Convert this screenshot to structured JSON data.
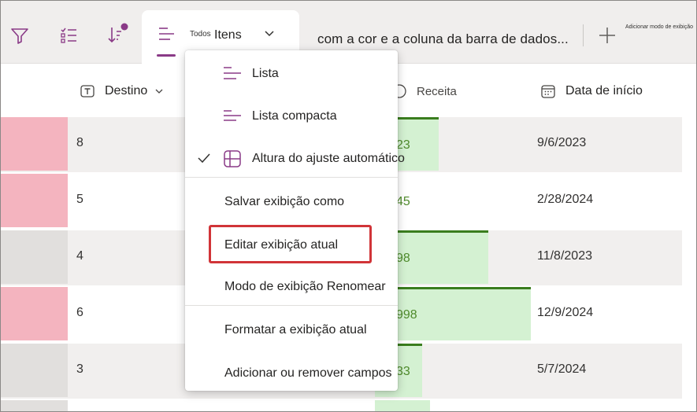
{
  "toolbar": {
    "filter_icon": "filter-icon",
    "group_icon": "group-icon",
    "sort_icon": "sort-icon",
    "active_tab": {
      "small_prefix": "Todos",
      "label": "Itens"
    },
    "view_title": "com a cor e a coluna da barra de dados...",
    "add_view_label": "Adicionar modo de exibição"
  },
  "columns": [
    {
      "label": "Destino",
      "icon": "text-field-icon"
    },
    {
      "label": "Receita",
      "icon": "currency-icon"
    },
    {
      "label": "Data de início",
      "icon": "calendar-icon"
    }
  ],
  "rows": [
    {
      "num": "8",
      "revenue": "23",
      "date": "9/6/2023",
      "swatch": "#f4b4bf",
      "bar": 0.27
    },
    {
      "num": "5",
      "revenue": "45",
      "date": "2/28/2024",
      "swatch": "#f4b4bf",
      "bar": 0.0
    },
    {
      "num": "4",
      "revenue": "98",
      "date": "11/8/2023",
      "swatch": "#e1dfdd",
      "bar": 0.48
    },
    {
      "num": "6",
      "revenue": "998",
      "date": "12/9/2024",
      "swatch": "#f4b4bf",
      "bar": 0.66
    },
    {
      "num": "3",
      "revenue": "33",
      "date": "5/7/2024",
      "swatch": "#e1dfdd",
      "bar": 0.2
    }
  ],
  "menu": {
    "items": [
      {
        "label": "Lista",
        "icon": "list-icon"
      },
      {
        "label": "Lista compacta",
        "icon": "compact-list-icon"
      },
      {
        "label": "Altura do ajuste automático",
        "icon": "autofit-height-icon",
        "checked": true
      },
      {
        "label": "Salvar exibição como"
      },
      {
        "label": "Editar exibição atual"
      },
      {
        "label": "Modo de exibição Renomear"
      },
      {
        "label": "Formatar a exibição atual"
      },
      {
        "label": "Adicionar ou remover campos"
      }
    ]
  },
  "colors": {
    "accent": "#8a3a87",
    "bar_fill": "#d4f1d2",
    "bar_border": "#3a7d1e",
    "highlight": "#d13438"
  }
}
